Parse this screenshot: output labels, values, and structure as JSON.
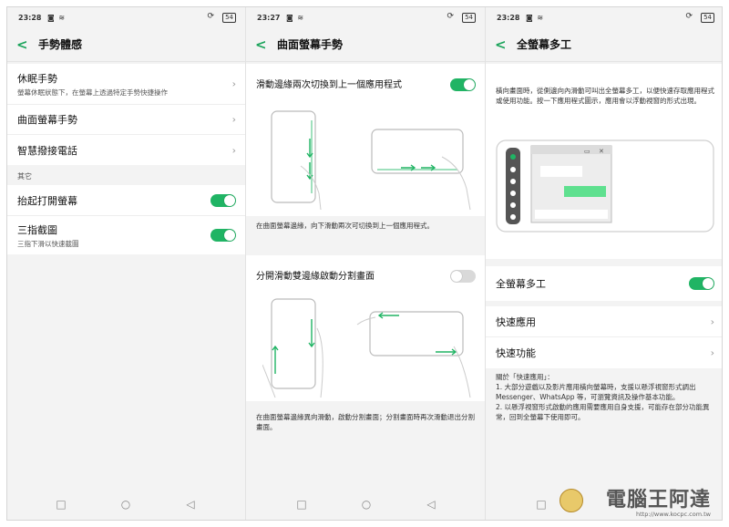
{
  "screen1": {
    "status_time": "23:28",
    "status_battery": "54",
    "title": "手勢體感",
    "items": [
      {
        "title": "休眠手勢",
        "subtitle": "螢幕休眠狀態下，在螢幕上透過特定手勢快捷操作"
      },
      {
        "title": "曲面螢幕手勢"
      },
      {
        "title": "智慧撥接電話"
      }
    ],
    "section_label": "其它",
    "toggles": [
      {
        "title": "抬起打開螢幕",
        "on": true
      },
      {
        "title": "三指截圖",
        "subtitle": "三指下滑以快速截圖",
        "on": true
      }
    ]
  },
  "screen2": {
    "status_time": "23:27",
    "status_battery": "54",
    "title": "曲面螢幕手勢",
    "feature1_title": "滑動邊緣兩次切換到上一個應用程式",
    "feature1_on": true,
    "feature1_desc": "在曲面螢幕邊緣，向下滑動兩次可切換到上一個應用程式。",
    "feature2_title": "分開滑動雙邊緣啟動分割畫面",
    "feature2_on": false,
    "feature2_desc": "在曲面螢幕邊緣異向滑動，啟動分割畫面；分割畫面時再次滑動退出分割畫面。"
  },
  "screen3": {
    "status_time": "23:28",
    "status_battery": "54",
    "title": "全螢幕多工",
    "intro": "橫向畫面時，從側邊向內滑動可叫出全螢幕多工，以便快速存取應用程式或使用功能。按一下應用程式圖示，應用會以浮動視窗的形式出現。",
    "toggle_title": "全螢幕多工",
    "toggle_on": true,
    "items": [
      {
        "title": "快速應用"
      },
      {
        "title": "快速功能"
      }
    ],
    "notes": [
      "關於「快速應用」：",
      "1. 大部分遊戲以及影片應用橫向螢幕時，支援以懸浮視窗形式調出 Messenger、WhatsApp 等，可瀏覽資訊及操作基本功能。",
      "2. 以懸浮視窗形式啟動的應用需要應用自身支援，可能存在部分功能異常，回到全螢幕下使用即可。"
    ]
  },
  "watermark": {
    "name": "電腦王阿達",
    "url": "http://www.kocpc.com.tw"
  },
  "colors": {
    "accent": "#20b464",
    "background": "#f3f3f3"
  }
}
